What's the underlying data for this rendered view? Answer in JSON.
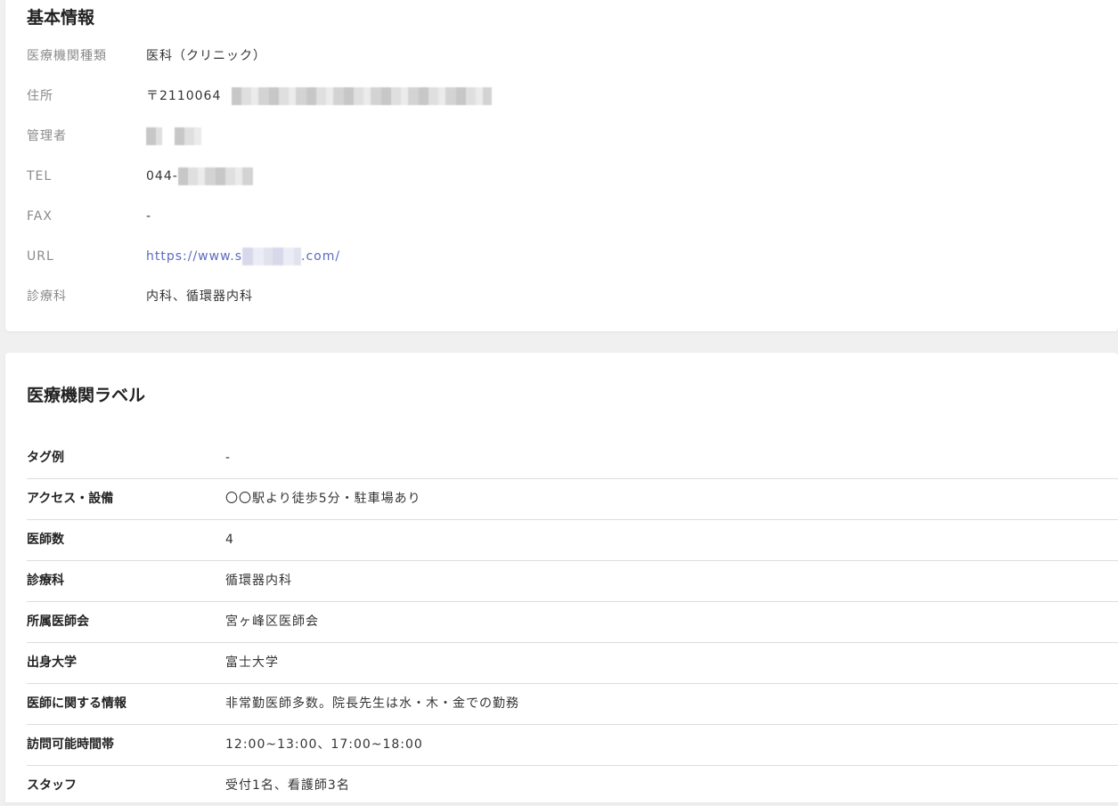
{
  "basic_info": {
    "title": "基本情報",
    "rows": {
      "type": {
        "label": "医療機関種類",
        "value": "医科（クリニック）"
      },
      "address": {
        "label": "住所",
        "value": "〒2110064"
      },
      "manager": {
        "label": "管理者"
      },
      "tel": {
        "label": "TEL",
        "value": "044-"
      },
      "fax": {
        "label": "FAX",
        "value": "-"
      },
      "url": {
        "label": "URL",
        "value_prefix": "https://www.s",
        "value_suffix": ".com/"
      },
      "department": {
        "label": "診療科",
        "value": "内科、循環器内科"
      }
    }
  },
  "labels": {
    "title": "医療機関ラベル",
    "rows": [
      {
        "label": "タグ例",
        "value": "-"
      },
      {
        "label": "アクセス・設備",
        "value": "〇〇駅より徒歩5分・駐車場あり"
      },
      {
        "label": "医師数",
        "value": "4"
      },
      {
        "label": "診療科",
        "value": "循環器内科"
      },
      {
        "label": "所属医師会",
        "value": "宮ヶ峰区医師会"
      },
      {
        "label": "出身大学",
        "value": "富士大学"
      },
      {
        "label": "医師に関する情報",
        "value": "非常勤医師多数。院長先生は水・木・金での勤務"
      },
      {
        "label": "訪問可能時間帯",
        "value": "12:00~13:00、17:00~18:00"
      },
      {
        "label": "スタッフ",
        "value": "受付1名、看護師3名"
      }
    ]
  },
  "colors": {
    "page_background": "#f0f0f0",
    "card_background": "#ffffff",
    "label_gray": "#8a8a8a",
    "link": "#5c6bc0",
    "divider": "#dddddd"
  }
}
